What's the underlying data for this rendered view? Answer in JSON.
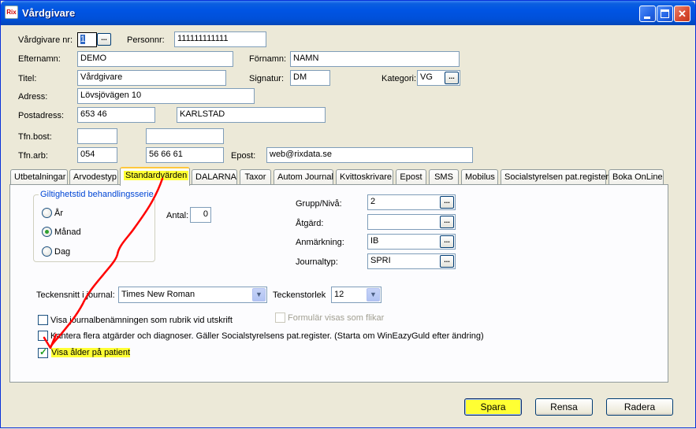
{
  "window": {
    "title": "Vårdgivare",
    "app_icon_text": "Rix"
  },
  "form": {
    "vardgivare_nr_label": "Vårdgivare nr:",
    "vardgivare_nr_value": "1",
    "personnr_label": "Personnr:",
    "personnr_value": "111111111111",
    "efternamn_label": "Efternamn:",
    "efternamn_value": "DEMO",
    "fornamn_label": "Förnamn:",
    "fornamn_value": "NAMN",
    "titel_label": "Titel:",
    "titel_value": "Vårdgivare",
    "signatur_label": "Signatur:",
    "signatur_value": "DM",
    "kategori_label": "Kategori:",
    "kategori_value": "VG",
    "adress_label": "Adress:",
    "adress_value": "Lövsjövägen 10",
    "postadress_label": "Postadress:",
    "postnr_value": "653 46",
    "ort_value": "KARLSTAD",
    "tfn_bost_label": "Tfn.bost:",
    "tfn_bost_area": "",
    "tfn_bost_number": "",
    "tfn_arb_label": "Tfn.arb:",
    "tfn_arb_area": "054",
    "tfn_arb_number": "56 66 61",
    "epost_label": "Epost:",
    "epost_value": "web@rixdata.se",
    "ellipsis": "..."
  },
  "tabs": [
    {
      "label": "Utbetalningar"
    },
    {
      "label": "Arvodestyp"
    },
    {
      "label": "Standardvärden"
    },
    {
      "label": "DALARNA"
    },
    {
      "label": "Taxor"
    },
    {
      "label": "Autom Journal"
    },
    {
      "label": "Kvittoskrivare"
    },
    {
      "label": "Epost"
    },
    {
      "label": "SMS"
    },
    {
      "label": "Mobilus"
    },
    {
      "label": "Socialstyrelsen pat.register"
    },
    {
      "label": "Boka OnLine"
    }
  ],
  "standard": {
    "group_title": "Giltighetstid behandlingsserie",
    "radios": [
      {
        "label": "År",
        "checked": false
      },
      {
        "label": "Månad",
        "checked": true
      },
      {
        "label": "Dag",
        "checked": false
      }
    ],
    "antal_label": "Antal:",
    "antal_value": "0",
    "grupp_label": "Grupp/Nivå:",
    "grupp_value": "2",
    "atgard_label": "Åtgärd:",
    "atgard_value": "",
    "anmarkning_label": "Anmärkning:",
    "anmarkning_value": "IB",
    "journaltyp_label": "Journaltyp:",
    "journaltyp_value": "SPRI",
    "font_label": "Teckensnitt i journal:",
    "font_value": "Times New Roman",
    "size_label": "Teckenstorlek",
    "size_value": "12",
    "check_rubrik": "Visa journalbenämningen som rubrik vid utskrift",
    "check_flikar": "Formulär visas som flikar",
    "check_flera": "Kantera flera atgärder och diagnoser. Gäller Socialstyrelsens pat.register. (Starta om WinEazyGuld efter ändring)",
    "check_alder": "Visa ålder på patient"
  },
  "buttons": {
    "spara": "Spara",
    "rensa": "Rensa",
    "radera": "Radera"
  },
  "colors": {
    "highlight": "#ffff33",
    "annotation": "#ff0000",
    "title_bar": "#0054e3"
  }
}
